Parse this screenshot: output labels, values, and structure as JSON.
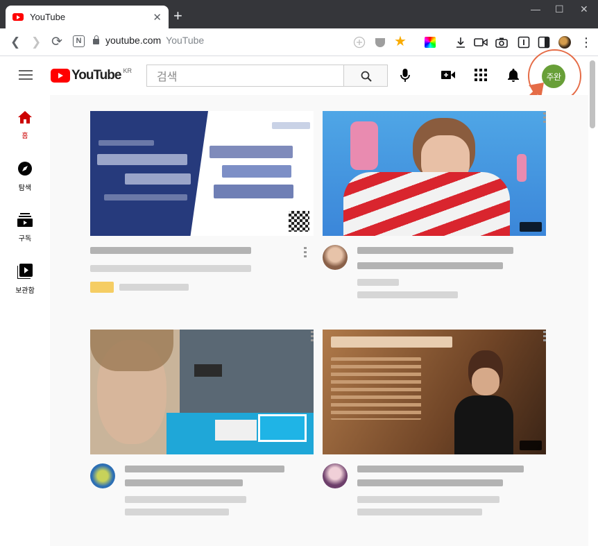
{
  "browser": {
    "tab_title": "YouTube",
    "tab_close": "✕",
    "new_tab": "+",
    "window_controls": {
      "minimize": "—",
      "maximize": "☐",
      "close": "✕"
    },
    "nav": {
      "back": "❮",
      "forward": "❯",
      "reload": "⟳",
      "notion_ext": "N"
    },
    "omnibox": {
      "host": "youtube.com",
      "page_title": "YouTube"
    },
    "menu": "⋮"
  },
  "youtube": {
    "logo_text": "YouTube",
    "region": "KR",
    "search_placeholder": "검색",
    "account_initials": "주완",
    "account_color": "#689f38",
    "brand_red": "#ff0000",
    "highlight_color": "#e56c47"
  },
  "guide": {
    "items": [
      {
        "label": "홈",
        "icon": "home-icon",
        "active": true
      },
      {
        "label": "탐색",
        "icon": "compass-icon",
        "active": false
      },
      {
        "label": "구독",
        "icon": "subscriptions-icon",
        "active": false
      },
      {
        "label": "보관함",
        "icon": "library-icon",
        "active": false
      }
    ]
  },
  "videos": [
    {
      "thumbnail": "navy-banner-ad",
      "is_ad": true
    },
    {
      "thumbnail": "blue-background-phone-cords"
    },
    {
      "thumbnail": "pool-blue-stage"
    },
    {
      "thumbnail": "brown-dress-concert"
    }
  ]
}
